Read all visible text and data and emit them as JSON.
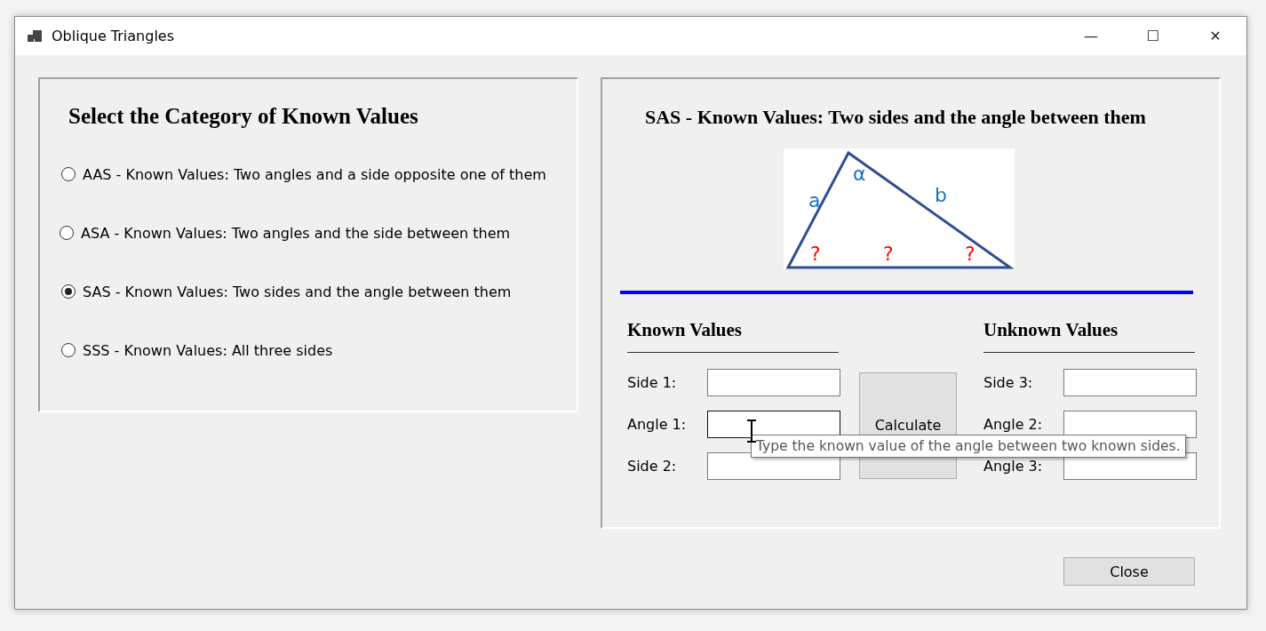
{
  "window": {
    "title": "Oblique Triangles",
    "controls": [
      "—",
      "☐",
      "✕"
    ]
  },
  "category_group": {
    "title": "Select the Category of Known Values",
    "options": [
      {
        "label": "AAS - Known Values: Two angles and a side opposite one of them",
        "selected": false
      },
      {
        "label": "ASA - Known Values: Two angles and the side between them",
        "selected": false
      },
      {
        "label": "SAS - Known Values: Two sides and the angle between them",
        "selected": true
      },
      {
        "label": "SSS - Known Values: All three sides",
        "selected": false
      }
    ]
  },
  "detail_group": {
    "title": "SAS - Known Values: Two sides and the angle between them",
    "diagram": {
      "known": [
        {
          "label": "a",
          "kind": "side-left"
        },
        {
          "label": "α",
          "kind": "apex-angle"
        },
        {
          "label": "b",
          "kind": "side-right"
        }
      ],
      "unknown": [
        {
          "label": "?",
          "kind": "left-angle"
        },
        {
          "label": "?",
          "kind": "base"
        },
        {
          "label": "?",
          "kind": "right-angle"
        }
      ]
    },
    "known": {
      "title": "Known Values",
      "fields": [
        {
          "label": "Side 1:",
          "focused": false
        },
        {
          "label": "Angle 1:",
          "focused": true
        },
        {
          "label": "Side 2:",
          "focused": false
        }
      ]
    },
    "calculate_button": "Calculate",
    "unknown": {
      "title": "Unknown Values",
      "fields": [
        {
          "label": "Side 3:",
          "focused": false
        },
        {
          "label": "Angle 2:",
          "focused": false
        },
        {
          "label": "Angle 3:",
          "focused": false
        }
      ]
    }
  },
  "tooltip": "Type the known value of the angle between two known sides.",
  "close_button": "Close"
}
